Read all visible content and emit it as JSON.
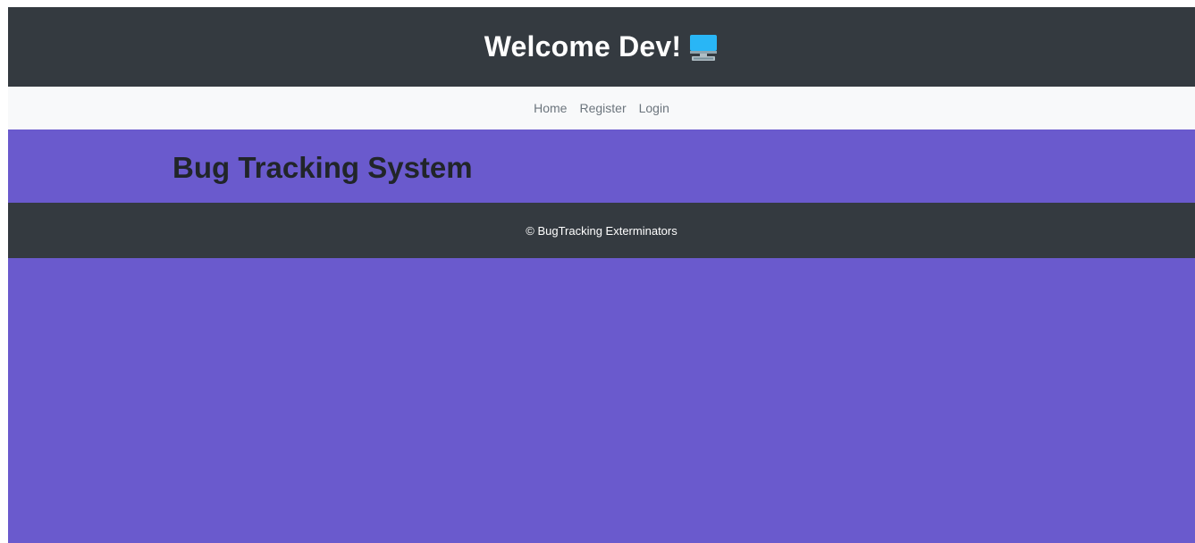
{
  "header": {
    "title": "Welcome Dev!",
    "icon": "computer-icon"
  },
  "nav": {
    "items": [
      {
        "label": "Home"
      },
      {
        "label": "Register"
      },
      {
        "label": "Login"
      }
    ]
  },
  "hero": {
    "title": "Bug Tracking System"
  },
  "footer": {
    "text": "© BugTracking Exterminators"
  },
  "colors": {
    "header_bg": "#343a40",
    "nav_bg": "#f8f9fa",
    "page_bg": "#6a5acd",
    "nav_link": "#6c757d",
    "hero_text": "#212529"
  }
}
